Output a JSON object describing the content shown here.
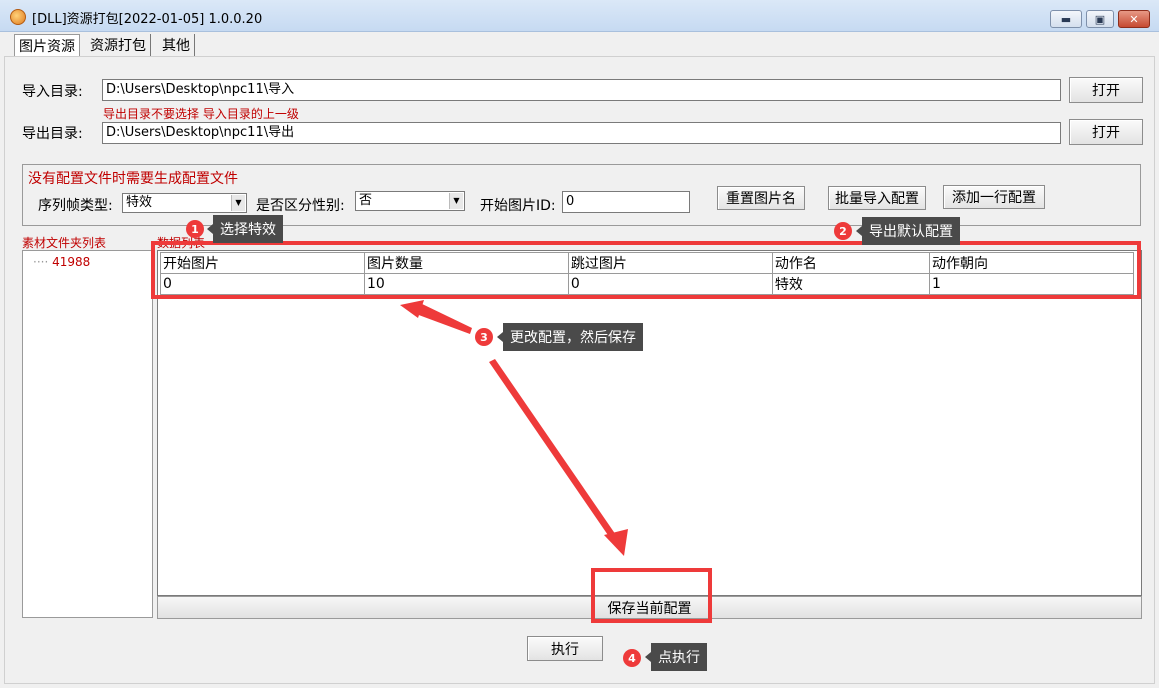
{
  "window": {
    "title": "[DLL]资源打包[2022-01-05] 1.0.0.20",
    "minimize_label": "▬",
    "restore_label": "▣",
    "close_label": "✕"
  },
  "tabs": [
    {
      "label": "图片资源"
    },
    {
      "label": "资源打包"
    },
    {
      "label": "其他"
    }
  ],
  "import_dir": {
    "label": "导入目录:",
    "value": "D:\\Users\\Desktop\\npc11\\导入",
    "button": "打开"
  },
  "warning": "导出目录不要选择 导入目录的上一级",
  "export_dir": {
    "label": "导出目录:",
    "value": "D:\\Users\\Desktop\\npc11\\导出",
    "button": "打开"
  },
  "config": {
    "notice": "没有配置文件时需要生成配置文件",
    "frame_type_label": "序列帧类型:",
    "frame_type_value": "特效",
    "gender_label": "是否区分性别:",
    "gender_value": "否",
    "start_id_label": "开始图片ID:",
    "start_id_value": "0",
    "reset_button": "重置图片名",
    "batch_import_button": "批量导入配置",
    "add_row_button": "添加一行配置"
  },
  "tree": {
    "label": "素材文件夹列表",
    "items": [
      {
        "label": "41988"
      }
    ]
  },
  "grid": {
    "label": "数据列表",
    "columns": [
      "开始图片",
      "图片数量",
      "跳过图片",
      "动作名",
      "动作朝向"
    ],
    "rows": [
      [
        "0",
        "10",
        "0",
        "特效",
        "1"
      ]
    ]
  },
  "save_button": "保存当前配置",
  "execute_button": "执行",
  "annotations": [
    {
      "num": "1",
      "text": "选择特效"
    },
    {
      "num": "2",
      "text": "导出默认配置"
    },
    {
      "num": "3",
      "text": "更改配置，然后保存"
    },
    {
      "num": "4",
      "text": "点执行"
    }
  ],
  "colors": {
    "accent_red": "#ee3a3a",
    "label_red": "#c00000",
    "callout_bg": "#4a4a4a"
  }
}
